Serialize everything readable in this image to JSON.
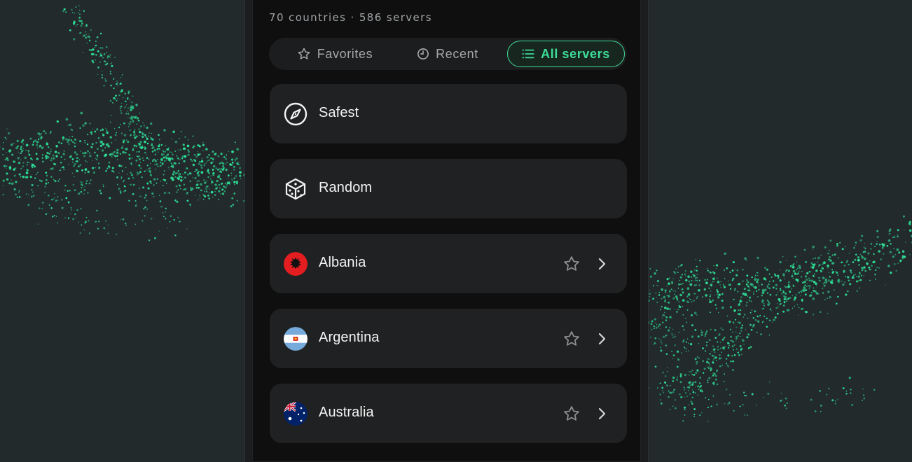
{
  "header": {
    "stats": "70 countries · 586 servers"
  },
  "tabs": [
    {
      "label": "Favorites",
      "icon": "star-outline-icon",
      "active": false
    },
    {
      "label": "Recent",
      "icon": "clock-icon",
      "active": false
    },
    {
      "label": "All servers",
      "icon": "list-icon",
      "active": true
    }
  ],
  "rows": [
    {
      "label": "Safest",
      "icon": "compass-icon"
    },
    {
      "label": "Random",
      "icon": "dice-icon"
    },
    {
      "label": "Albania",
      "icon": "albania-flag-icon",
      "favorite": false
    },
    {
      "label": "Argentina",
      "icon": "argentina-flag-icon",
      "favorite": false
    },
    {
      "label": "Australia",
      "icon": "australia-flag-icon",
      "favorite": false
    }
  ],
  "colors": {
    "accent": "#3ddc97",
    "background": "#232a2c",
    "panel": "#0f0f0f",
    "card": "#202122"
  }
}
